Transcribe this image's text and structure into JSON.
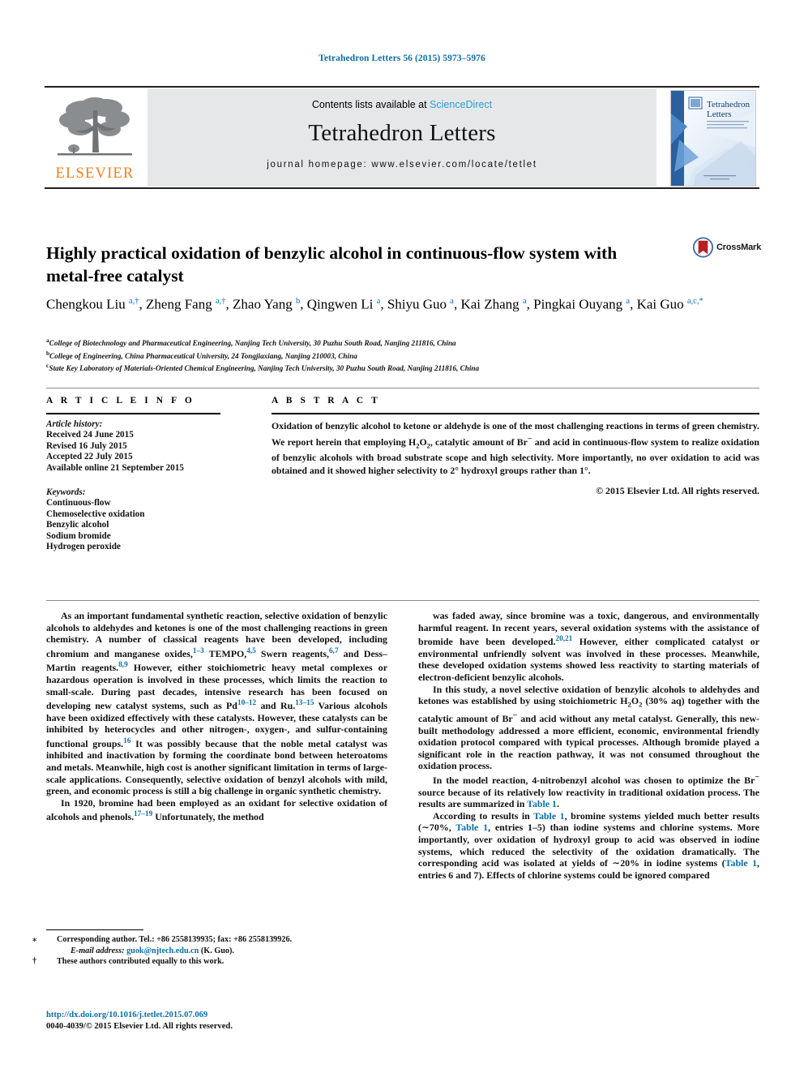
{
  "running_head": "Tetrahedron Letters 56 (2015) 5973–5976",
  "masthead": {
    "contents_prefix": "Contents lists available at ",
    "contents_link": "ScienceDirect",
    "journal_name": "Tetrahedron Letters",
    "homepage": "journal homepage: www.elsevier.com/locate/tetlet",
    "publisher_logo_text": "ELSEVIER",
    "cover_title_line1": "Tetrahedron",
    "cover_title_line2": "Letters"
  },
  "article": {
    "title": "Highly practical oxidation of benzylic alcohol in continuous-flow system with metal-free catalyst",
    "crossmark_label": "CrossMark",
    "authors_html": "Chengkou Liu <sup>a,†</sup>, Zheng Fang <sup>a,†</sup>, Zhao Yang <sup>b</sup>, Qingwen Li <sup>a</sup>, Shiyu Guo <sup>a</sup>, Kai Zhang <sup>a</sup>, Pingkai Ouyang <sup>a</sup>, Kai Guo <sup>a,c,*</sup>",
    "affiliations": [
      "College of Biotechnology and Pharmaceutical Engineering, Nanjing Tech University, 30 Puzhu South Road, Nanjing 211816, China",
      "College of Engineering, China Pharmaceutical University, 24 Tongjiaxiang, Nanjing 210003, China",
      "State Key Laboratory of Materials-Oriented Chemical Engineering, Nanjing Tech University, 30 Puzhu South Road, Nanjing 211816, China"
    ],
    "affiliation_marks": [
      "a",
      "b",
      "c"
    ]
  },
  "article_info": {
    "heading": "A R T I C L E    I N F O",
    "history_label": "Article history:",
    "history": [
      "Received 24 June 2015",
      "Revised 16 July 2015",
      "Accepted 22 July 2015",
      "Available online 21 September 2015"
    ],
    "keywords_label": "Keywords:",
    "keywords": [
      "Continuous-flow",
      "Chemoselective oxidation",
      "Benzylic alcohol",
      "Sodium bromide",
      "Hydrogen peroxide"
    ]
  },
  "abstract": {
    "heading": "A B S T R A C T",
    "text_html": "Oxidation of benzylic alcohol to ketone or aldehyde is one of the most challenging reactions in terms of green chemistry. We report herein that employing H<sub>2</sub>O<sub>2</sub>, catalytic amount of Br<sup>−</sup> and acid in continuous-flow system to realize oxidation of benzylic alcohols with broad substrate scope and high selectivity. More importantly, no over oxidation to acid was obtained and it showed higher selectivity to 2° hydroxyl groups rather than 1°.",
    "copyright": "© 2015 Elsevier Ltd. All rights reserved."
  },
  "body": {
    "left_column_html": [
      "As an important fundamental synthetic reaction, selective oxidation of benzylic alcohols to aldehydes and ketones is one of the most challenging reactions in green chemistry. A number of classical reagents have been developed, including chromium and manganese oxides,<sup class=\"ref\">1–3</sup> TEMPO,<sup class=\"ref\">4,5</sup> Swern reagents,<sup class=\"ref\">6,7</sup> and Dess–Martin reagents.<sup class=\"ref\">8,9</sup> However, either stoichiometric heavy metal complexes or hazardous operation is involved in these processes, which limits the reaction to small-scale. During past decades, intensive research has been focused on developing new catalyst systems, such as Pd<sup class=\"ref\">10–12</sup> and Ru.<sup class=\"ref\">13–15</sup> Various alcohols have been oxidized effectively with these catalysts. However, these catalysts can be inhibited by heterocycles and other nitrogen-, oxygen-, and sulfur-containing functional groups.<sup class=\"ref\">16</sup> It was possibly because that the noble metal catalyst was inhibited and inactivation by forming the coordinate bond between heteroatoms and metals. Meanwhile, high cost is another significant limitation in terms of large-scale applications. Consequently, selective oxidation of benzyl alcohols with mild, green, and economic process is still a big challenge in organic synthetic chemistry.",
      "In 1920, bromine had been employed as an oxidant for selective oxidation of alcohols and phenols.<sup class=\"ref\">17–19</sup> Unfortunately, the method"
    ],
    "right_column_html": [
      "was faded away, since bromine was a toxic, dangerous, and environmentally harmful reagent. In recent years, several oxidation systems with the assistance of bromide have been developed.<sup class=\"ref\">20,21</sup> However, either complicated catalyst or environmental unfriendly solvent was involved in these processes. Meanwhile, these developed oxidation systems showed less reactivity to starting materials of electron-deficient benzylic alcohols.",
      "In this study, a novel selective oxidation of benzylic alcohols to aldehydes and ketones was established by using stoichiometric H<sub>2</sub>O<sub>2</sub> (30% aq) together with the catalytic amount of Br<sup>−</sup> and acid without any metal catalyst. Generally, this new-built methodology addressed a more efficient, economic, environmental friendly oxidation protocol compared with typical processes. Although bromide played a significant role in the reaction pathway, it was not consumed throughout the oxidation process.",
      "In the model reaction, 4-nitrobenzyl alcohol was chosen to optimize the Br<sup>−</sup> source because of its relatively low reactivity in traditional oxidation process. The results are summarized in <span class=\"lnk\">Table 1</span>.",
      "According to results in <span class=\"lnk\">Table 1</span>, bromine systems yielded much better results (∼70%, <span class=\"lnk\">Table 1</span>, entries 1–5) than iodine systems and chlorine systems. More importantly, over oxidation of hydroxyl group to acid was observed in iodine systems, which reduced the selectivity of the oxidation dramatically. The corresponding acid was isolated at yields of ∼20% in iodine systems (<span class=\"lnk\">Table 1</span>, entries 6 and 7). Effects of chlorine systems could be ignored compared"
    ]
  },
  "footnotes": {
    "corresponding_mark": "⁎",
    "corresponding_text": "Corresponding author. Tel.: +86 2558139935; fax: +86 2558139926.",
    "email_label": "E-mail address:",
    "email": "guok@njtech.edu.cn",
    "email_suffix": "(K. Guo).",
    "equal_mark": "†",
    "equal_text": "These authors contributed equally to this work."
  },
  "colophon": {
    "doi": "http://dx.doi.org/10.1016/j.tetlet.2015.07.069",
    "issn_line": "0040-4039/© 2015 Elsevier Ltd. All rights reserved."
  },
  "colors": {
    "link_blue": "#0b6ea8",
    "sciencedirect_blue": "#2a9fd6",
    "elsevier_orange": "#f07f1a",
    "band_gray": "#e6e7e8"
  }
}
